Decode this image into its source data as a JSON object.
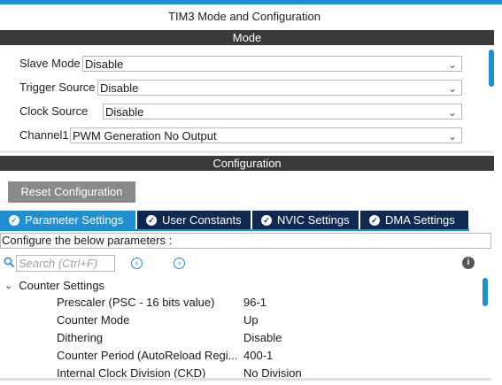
{
  "window": {
    "title": "TIM3 Mode and Configuration"
  },
  "mode": {
    "header": "Mode",
    "rows": [
      {
        "label": "Slave Mode",
        "value": "Disable"
      },
      {
        "label": "Trigger Source",
        "value": "Disable"
      },
      {
        "label": "Clock Source",
        "value": "Disable"
      },
      {
        "label": "Channel1",
        "value": "PWM Generation No Output"
      }
    ]
  },
  "configuration": {
    "header": "Configuration",
    "reset_button": "Reset Configuration",
    "tabs": [
      {
        "label": "Parameter Settings",
        "active": true
      },
      {
        "label": "User Constants",
        "active": false
      },
      {
        "label": "NVIC Settings",
        "active": false
      },
      {
        "label": "DMA Settings",
        "active": false
      }
    ],
    "configure_text": "Configure the below parameters :",
    "search": {
      "placeholder": "Search (Ctrl+F)"
    },
    "icons": {
      "search": "search-icon",
      "prev": "chevron-left-icon",
      "next": "chevron-right-icon",
      "info": "info-icon",
      "check": "check-icon"
    },
    "group": {
      "label": "Counter Settings",
      "params": [
        {
          "name": "Prescaler (PSC - 16 bits value)",
          "value": "96-1"
        },
        {
          "name": "Counter Mode",
          "value": "Up"
        },
        {
          "name": "Dithering",
          "value": "Disable"
        },
        {
          "name": "Counter Period (AutoReload Regi...",
          "value": "400-1"
        },
        {
          "name": "Internal Clock Division (CKD)",
          "value": "No Division"
        }
      ]
    }
  },
  "colors": {
    "accent": "#1e8fd0",
    "tab_bg": "#0f2a52",
    "section_bar": "#3a3a3a",
    "button": "#8a8a8a"
  }
}
